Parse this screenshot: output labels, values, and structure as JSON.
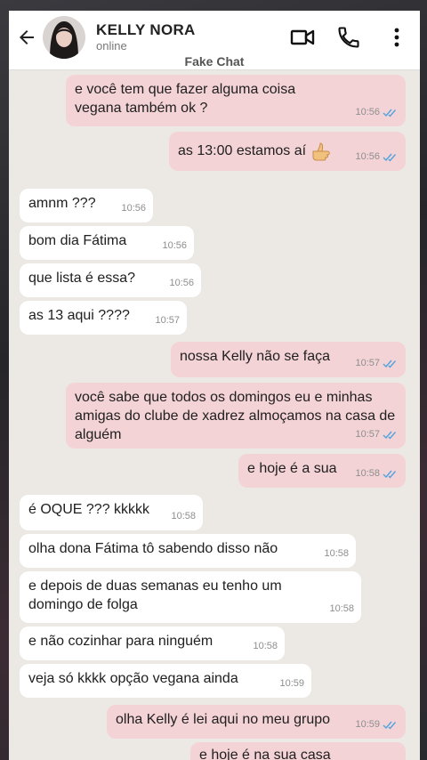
{
  "header": {
    "contact_name": "KELLY NORA",
    "status": "online",
    "watermark": "Fake Chat"
  },
  "messages": [
    {
      "dir": "out",
      "text": "e você tem que fazer alguma coisa vegana também ok ?",
      "time": "10:56"
    },
    {
      "dir": "out",
      "text": "as 13:00 estamos aí",
      "time": "10:56"
    },
    {
      "dir": "in",
      "text": "amnm ???",
      "time": "10:56"
    },
    {
      "dir": "in",
      "text": "bom dia Fátima",
      "time": "10:56"
    },
    {
      "dir": "in",
      "text": "que lista é essa?",
      "time": "10:56"
    },
    {
      "dir": "in",
      "text": "as 13 aqui ????",
      "time": "10:57"
    },
    {
      "dir": "out",
      "text": "nossa Kelly não se faça",
      "time": "10:57"
    },
    {
      "dir": "out",
      "text": "você sabe que todos os domingos eu e minhas amigas do clube de xadrez almoçamos na casa de alguém",
      "time": "10:57"
    },
    {
      "dir": "out",
      "text": "e hoje é a sua",
      "time": "10:58"
    },
    {
      "dir": "in",
      "text": "é OQUE ??? kkkkk",
      "time": "10:58"
    },
    {
      "dir": "in",
      "text": "olha dona Fátima tô sabendo disso não",
      "time": "10:58"
    },
    {
      "dir": "in",
      "text": "e depois de duas semanas eu tenho um domingo de folga",
      "time": "10:58"
    },
    {
      "dir": "in",
      "text": "e não cozinhar para ninguém",
      "time": "10:58"
    },
    {
      "dir": "in",
      "text": "veja só kkkk opção vegana ainda",
      "time": "10:59"
    },
    {
      "dir": "out",
      "text": "olha Kelly é lei aqui no meu grupo",
      "time": "10:59"
    },
    {
      "dir": "out",
      "text": "e hoje é na sua casa",
      "time": ""
    }
  ],
  "colors": {
    "outgoing_bubble": "#f4d3d6",
    "incoming_bubble": "#ffffff",
    "read_ticks": "#4fa3e0",
    "chat_background": "#ece8e3"
  },
  "icons": [
    "back-arrow-icon",
    "video-call-icon",
    "phone-icon",
    "more-vertical-icon",
    "double-check-icon",
    "thumbs-up-emoji"
  ]
}
